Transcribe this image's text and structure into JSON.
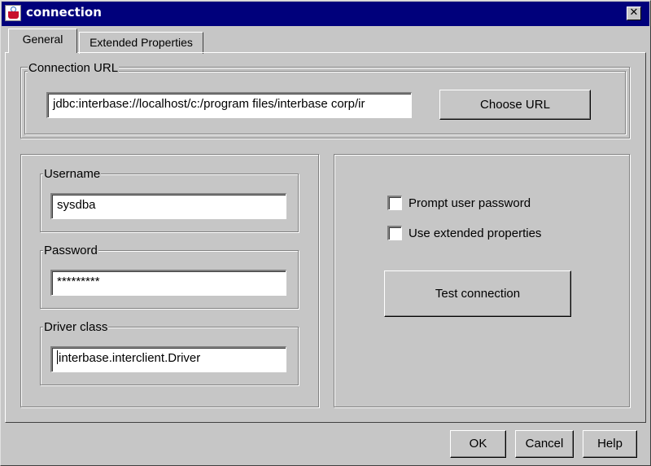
{
  "window": {
    "title": "connection",
    "close_glyph": "✕",
    "icon": "java-cup-icon"
  },
  "tabs": [
    {
      "label": "General",
      "selected": true
    },
    {
      "label": "Extended Properties",
      "selected": false
    }
  ],
  "connection_url": {
    "group_label": "Connection URL",
    "value": "jdbc:interbase://localhost/c:/program files/interbase corp/ir",
    "button_label": "Choose URL"
  },
  "credentials": {
    "username_label": "Username",
    "username_value": "sysdba",
    "password_label": "Password",
    "password_value": "*********",
    "driver_label": "Driver class",
    "driver_value": "interbase.interclient.Driver"
  },
  "options": {
    "prompt_password_label": "Prompt user password",
    "prompt_password_checked": false,
    "extended_props_label": "Use extended properties",
    "extended_props_checked": false,
    "test_button_label": "Test connection"
  },
  "footer": {
    "ok_label": "OK",
    "cancel_label": "Cancel",
    "help_label": "Help"
  }
}
